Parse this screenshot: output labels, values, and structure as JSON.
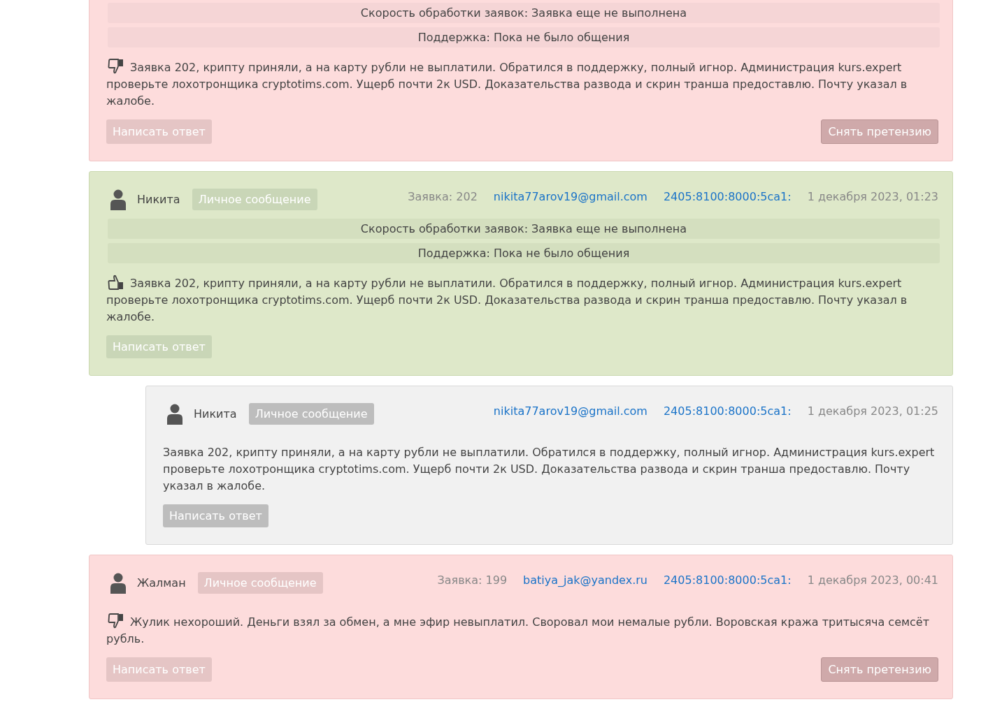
{
  "reviews": [
    {
      "kind": "negative",
      "statuses": [
        "Скорость обработки заявок: Заявка еще не выполнена",
        "Поддержка: Пока не было общения"
      ],
      "text": "Заявка 202, крипту приняли, а на карту рубли не выплатили. Обратился в поддержку, полный игнор. Администрация kurs.expert проверьте лохотронщика cryptotims.com. Ущерб почти 2к USD. Доказательства развода и скрин транша предоставлю. Почту указал в жалобе.",
      "reply_button": "Написать ответ",
      "retract_button": "Снять претензию"
    },
    {
      "kind": "positive",
      "author": "Никита",
      "badge": "Личное сообщение",
      "order": "Заявка: 202",
      "email": "nikita77arov19@gmail.com",
      "ip": "2405:8100:8000:5ca1:",
      "date": "1 декабря 2023, 01:23",
      "statuses": [
        "Скорость обработки заявок: Заявка еще не выполнена",
        "Поддержка: Пока не было общения"
      ],
      "text": "Заявка 202, крипту приняли, а на карту рубли не выплатили. Обратился в поддержку, полный игнор. Администрация kurs.expert проверьте лохотронщика cryptotims.com. Ущерб почти 2к USD. Доказательства развода и скрин транша предоставлю. Почту указал в жалобе.",
      "reply_button": "Написать ответ",
      "children": [
        {
          "kind": "reply",
          "author": "Никита",
          "badge": "Личное сообщение",
          "email": "nikita77arov19@gmail.com",
          "ip": "2405:8100:8000:5ca1:",
          "date": "1 декабря 2023, 01:25",
          "text": "Заявка 202, крипту приняли, а на карту рубли не выплатили. Обратился в поддержку, полный игнор. Администрация kurs.expert проверьте лохотронщика cryptotims.com. Ущерб почти 2к USD. Доказательства развода и скрин транша предоставлю. Почту указал в жалобе.",
          "reply_button": "Написать ответ"
        }
      ]
    },
    {
      "kind": "negative",
      "author": "Жалман",
      "badge": "Личное сообщение",
      "order": "Заявка: 199",
      "email": "batiya_jak@yandex.ru",
      "ip": "2405:8100:8000:5ca1:",
      "date": "1 декабря 2023, 00:41",
      "text": "Жулик нехороший. Деньги взял за обмен, а мне эфир невыплатил. Своровал мои немалые рубли. Воровская кража тритысяча семсёт рубль.",
      "reply_button": "Написать ответ",
      "retract_button": "Снять претензию"
    }
  ]
}
